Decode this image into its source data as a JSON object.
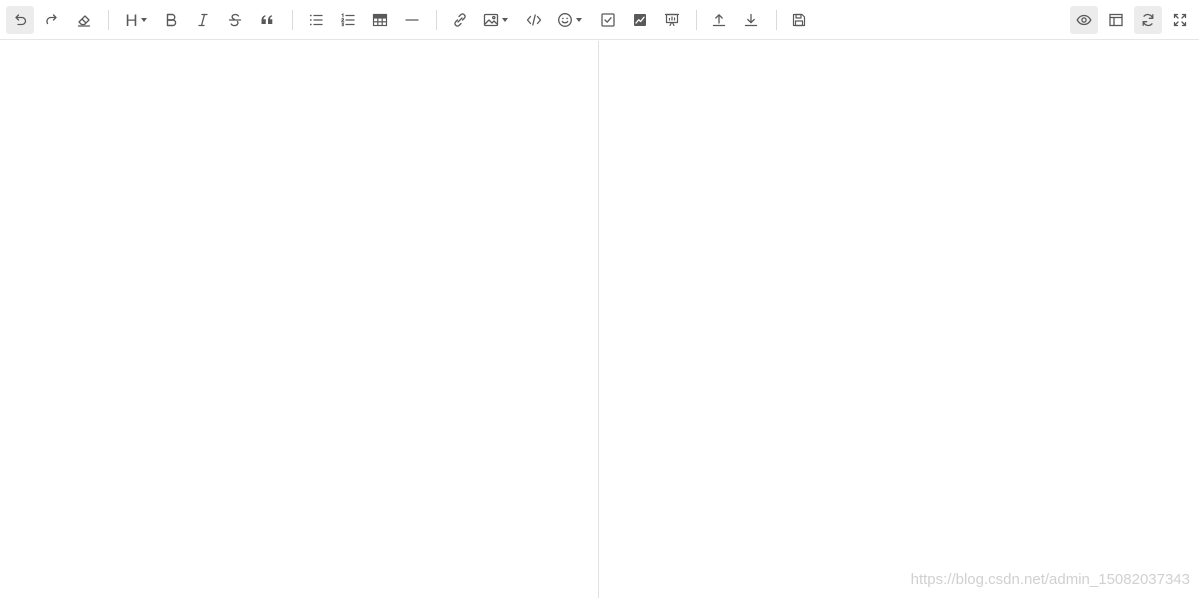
{
  "toolbar": {
    "left_groups": [
      [
        "undo-icon",
        "redo-icon",
        "eraser-icon"
      ],
      [
        "heading-icon",
        "bold-icon",
        "italic-icon",
        "strikethrough-icon",
        "quote-icon"
      ],
      [
        "unordered-list-icon",
        "ordered-list-icon",
        "table-icon",
        "horizontal-rule-icon"
      ],
      [
        "link-icon",
        "image-icon",
        "code-icon",
        "emoji-icon",
        "checkbox-icon",
        "chart-icon",
        "presentation-icon"
      ],
      [
        "upload-icon",
        "download-icon"
      ],
      [
        "save-icon"
      ]
    ],
    "heading_glyph": "H",
    "right_tools": [
      "eye-icon",
      "layout-icon",
      "sync-scroll-icon",
      "fullscreen-icon"
    ],
    "active_tools": [
      "eye-icon",
      "sync-scroll-icon"
    ]
  },
  "watermark": {
    "text": "https://blog.csdn.net/admin_15082037343"
  },
  "colors": {
    "icon": "#595959",
    "active_bg": "#ececec",
    "border": "#e6e6e6",
    "watermark": "#d0d0d0"
  }
}
